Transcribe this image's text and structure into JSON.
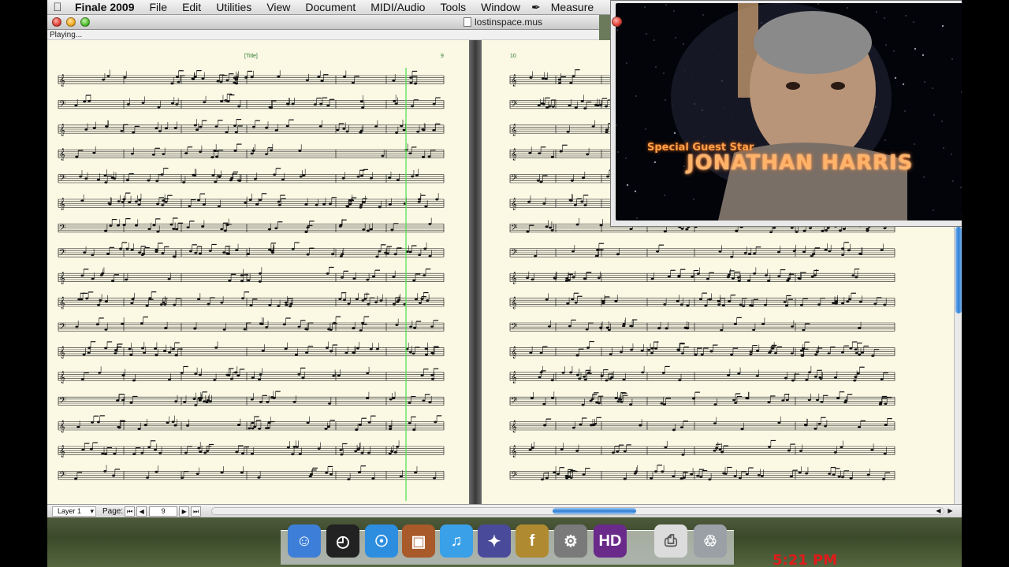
{
  "menubar": {
    "apple": "",
    "app_name": "Finale 2009",
    "items": [
      "File",
      "Edit",
      "Utilities",
      "View",
      "Document",
      "MIDI/Audio",
      "Tools",
      "Window",
      "Measure"
    ]
  },
  "window": {
    "title": "lostinspace.mus",
    "status": "Playing..."
  },
  "score": {
    "left_page_header": "[Title]",
    "left_page_measure": "9",
    "right_page_measure": "10",
    "staff_count": 17
  },
  "bottombar": {
    "layer": "Layer 1",
    "page_label": "Page:",
    "page_number": "9",
    "first": "⏮",
    "prev": "◀",
    "next": "▶",
    "last": "⏭"
  },
  "video": {
    "caption": "JONATHAN HARRIS",
    "caption_top": "Special Guest Star"
  },
  "dock": {
    "items": [
      {
        "name": "finder-icon",
        "glyph": "☺",
        "color": "#3d7fd8"
      },
      {
        "name": "dashboard-icon",
        "glyph": "◴",
        "color": "#222"
      },
      {
        "name": "safari-icon",
        "glyph": "☉",
        "color": "#2d8ee0"
      },
      {
        "name": "iphoto-icon",
        "glyph": "▣",
        "color": "#a85a2a"
      },
      {
        "name": "itunes-icon",
        "glyph": "♫",
        "color": "#3aa0e8"
      },
      {
        "name": "quicktime-icon",
        "glyph": "✦",
        "color": "#4a4a9a"
      },
      {
        "name": "finale-icon",
        "glyph": "f",
        "color": "#b08a30"
      },
      {
        "name": "system-preferences-icon",
        "glyph": "⚙",
        "color": "#7a7a7a"
      },
      {
        "name": "hd-video-icon",
        "glyph": "HD",
        "color": "#6a2a8a"
      },
      {
        "name": "pdf-document-icon",
        "glyph": "⎙",
        "color": "#dcdcdc"
      },
      {
        "name": "trash-icon",
        "glyph": "♲",
        "color": "#9aa0a6"
      }
    ],
    "watermark": "5:21 PM"
  }
}
